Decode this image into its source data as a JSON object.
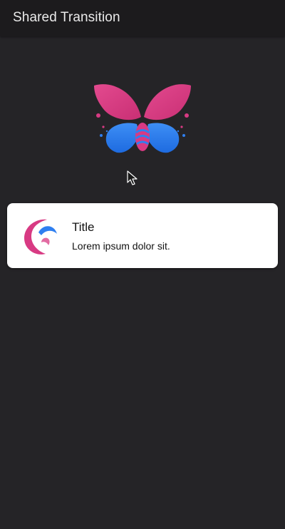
{
  "app_bar": {
    "title": "Shared Transition"
  },
  "hero": {
    "icon": "butterfly-logo-icon",
    "colors": {
      "pink": "#d83a83",
      "blue": "#2f7ff0"
    }
  },
  "cursor": {
    "icon": "mouse-pointer-icon"
  },
  "card": {
    "icon": "moon-swirl-logo-icon",
    "title": "Title",
    "subtitle": "Lorem ipsum dolor sit."
  }
}
